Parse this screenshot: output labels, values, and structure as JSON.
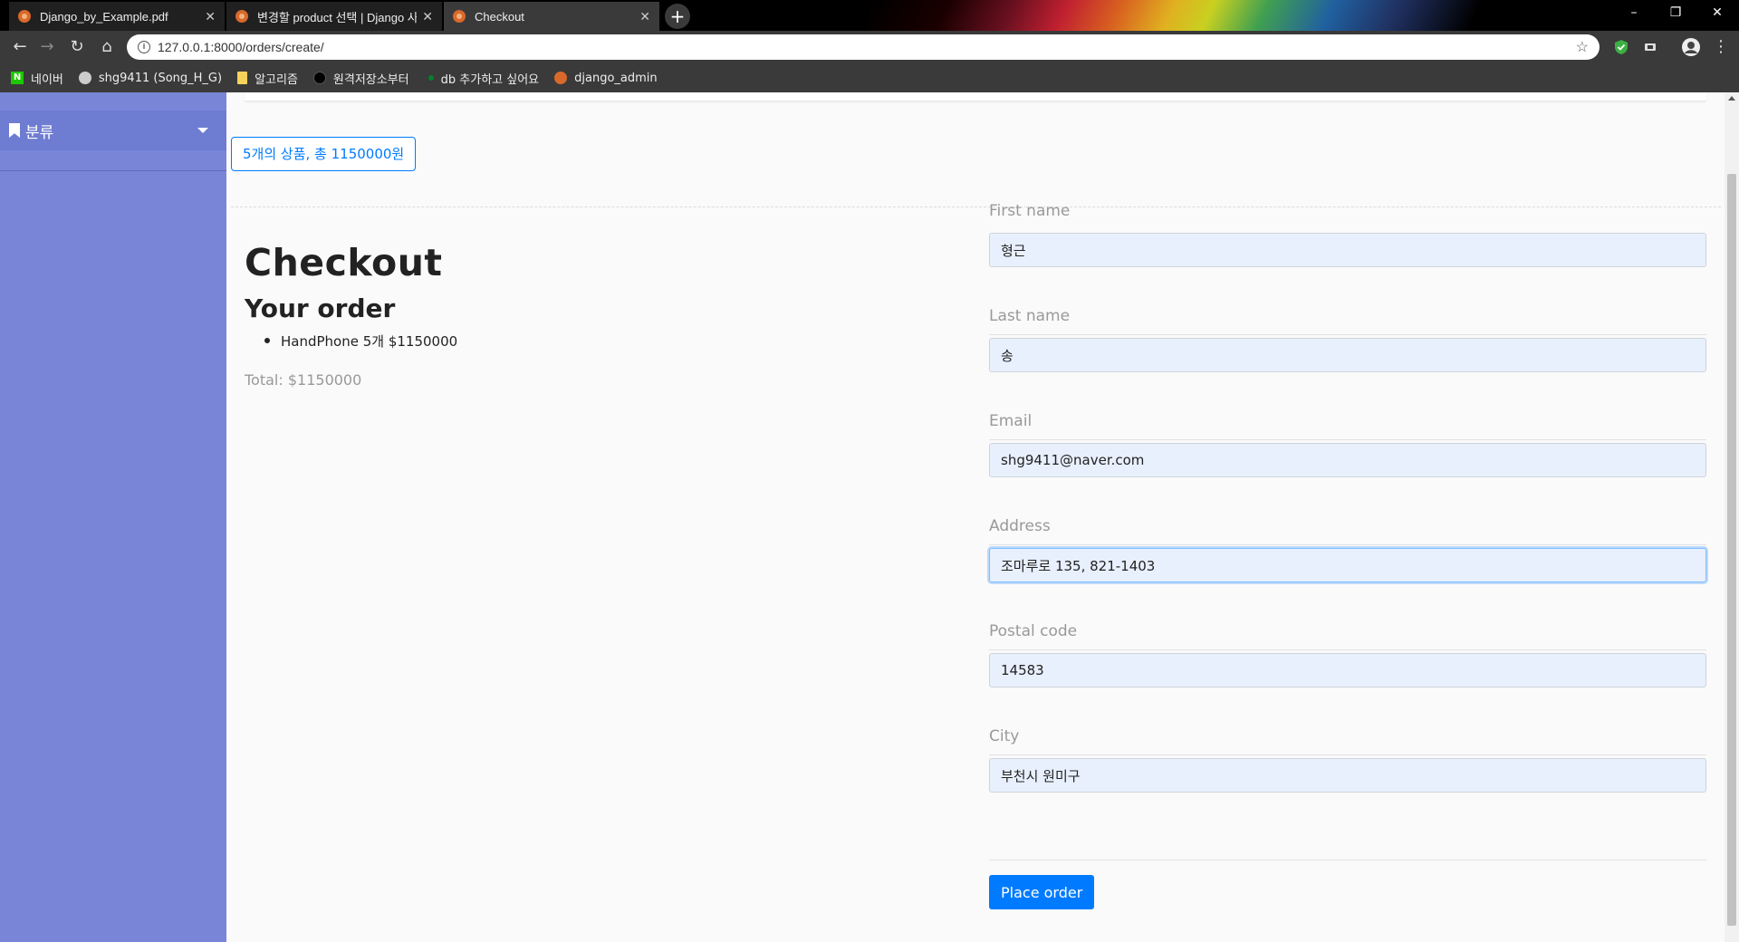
{
  "browser": {
    "tabs": [
      {
        "title": "Django_by_Example.pdf",
        "active": false
      },
      {
        "title": "변경할 product 선택 | Django 사",
        "active": false
      },
      {
        "title": "Checkout",
        "active": true
      }
    ],
    "url": "127.0.0.1:8000/orders/create/",
    "bookmarks": [
      {
        "label": "네이버",
        "icon": "naver-icon"
      },
      {
        "label": "shg9411 (Song_H_G)",
        "icon": "github-icon"
      },
      {
        "label": "알고리즘",
        "icon": "folder-icon"
      },
      {
        "label": "원격저장소부터",
        "icon": "circle-icon"
      },
      {
        "label": "db 추가하고 싶어요",
        "icon": "dot-icon"
      },
      {
        "label": "django_admin",
        "icon": "django-icon"
      }
    ]
  },
  "sidebar": {
    "category_label": "분류"
  },
  "cart_summary": "5개의 상품, 총 1150000원",
  "checkout": {
    "title": "Checkout",
    "order_heading": "Your order",
    "items": [
      {
        "text": "HandPhone 5개 $1150000"
      }
    ],
    "total": "Total: $1150000"
  },
  "form": {
    "fields": [
      {
        "label": "First name",
        "value": "형근"
      },
      {
        "label": "Last name",
        "value": "송"
      },
      {
        "label": "Email",
        "value": "shg9411@naver.com"
      },
      {
        "label": "Address",
        "value": "조마루로 135, 821-1403"
      },
      {
        "label": "Postal code",
        "value": "14583"
      },
      {
        "label": "City",
        "value": "부천시 원미구"
      }
    ],
    "submit_label": "Place order"
  },
  "colors": {
    "primary": "#007bff",
    "sidebar": "#7986d8",
    "input_bg": "#e8f0fe"
  }
}
